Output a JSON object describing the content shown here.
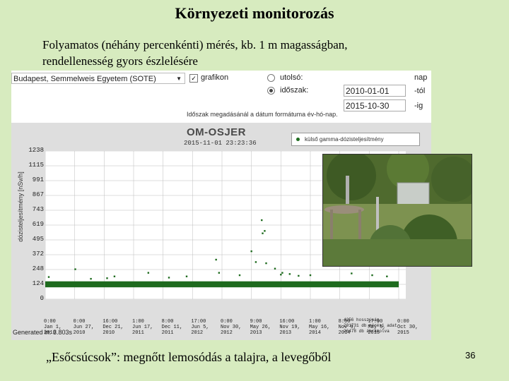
{
  "slide": {
    "title": "Környezeti monitorozás",
    "subtitle_line1": "Folyamatos (néhány percenkénti) mérés, kb. 1 m magasságban,",
    "subtitle_line2": "rendellenesség gyors észlelésére",
    "caption": "„Esőcsúcsok”: megnőtt lemosódás a talajra, a levegőből",
    "page_number": "36"
  },
  "form": {
    "station": "Budapest, Semmelweis Egyetem (SOTE)",
    "graph_checkbox_label": "grafikon",
    "graph_checked": true,
    "radio_last_label": "utolsó:",
    "radio_period_label": "időszak:",
    "period_selected": true,
    "last_suffix": "nap",
    "date_from": "2010-01-01",
    "date_from_suffix": "-tól",
    "date_to": "2015-10-30",
    "date_to_suffix": "-ig",
    "hint": "Időszak megadásánál a dátum formátuma év-hó-nap."
  },
  "chart": {
    "title": "OM-OSJER",
    "timestamp": "2015-11-01 23:23:36",
    "legend": "külső gamma-dózisteljesítmény",
    "series_color": "#1e6b1e",
    "y_label": "dózisteljesítmény [nSv/h]",
    "generated": "Generated in: 3.803s",
    "stats": [
      "4256 hosszúság",
      "201731 db mérési adat",
      "26478 db ábrázolva"
    ]
  },
  "chart_data": {
    "type": "scatter",
    "title": "OM-OSJER",
    "ylabel": "dózisteljesítmény [nSv/h]",
    "ylim": [
      0,
      1238
    ],
    "y_ticks": [
      "1238",
      "1115",
      "991",
      "867",
      "743",
      "619",
      "495",
      "372",
      "248",
      "124",
      "0"
    ],
    "x_ticks": [
      "0:00\nJan 1,\n2010",
      "0:00\nJun 27,\n2010",
      "16:00\nDec 21,\n2010",
      "1:00\nJun 17,\n2011",
      "8:00\nDec 11,\n2011",
      "17:00\nJun 5,\n2012",
      "0:00\nNov 30,\n2012",
      "9:00\nMay 26,\n2013",
      "16:00\nNov 19,\n2013",
      "1:00\nMay 16,\n2014",
      "8:00\nNov 9,\n2014",
      "17:00\nMay 5,\n2015",
      "0:00\nOct 30,\n2015"
    ],
    "baseline": 124,
    "series": [
      {
        "name": "külső gamma-dózisteljesítmény",
        "points": [
          {
            "x": 0.12,
            "y": 185
          },
          {
            "x": 1.02,
            "y": 250
          },
          {
            "x": 1.55,
            "y": 170
          },
          {
            "x": 2.1,
            "y": 175
          },
          {
            "x": 2.35,
            "y": 190
          },
          {
            "x": 3.5,
            "y": 220
          },
          {
            "x": 4.2,
            "y": 180
          },
          {
            "x": 4.8,
            "y": 190
          },
          {
            "x": 5.8,
            "y": 330
          },
          {
            "x": 5.9,
            "y": 220
          },
          {
            "x": 6.6,
            "y": 200
          },
          {
            "x": 7.0,
            "y": 400
          },
          {
            "x": 7.15,
            "y": 310
          },
          {
            "x": 7.35,
            "y": 660
          },
          {
            "x": 7.38,
            "y": 550
          },
          {
            "x": 7.45,
            "y": 570
          },
          {
            "x": 7.5,
            "y": 300
          },
          {
            "x": 7.8,
            "y": 255
          },
          {
            "x": 8.0,
            "y": 205
          },
          {
            "x": 8.05,
            "y": 220
          },
          {
            "x": 8.3,
            "y": 210
          },
          {
            "x": 8.6,
            "y": 195
          },
          {
            "x": 9.0,
            "y": 200
          },
          {
            "x": 10.0,
            "y": 285
          },
          {
            "x": 10.3,
            "y": 350
          },
          {
            "x": 10.4,
            "y": 215
          },
          {
            "x": 11.1,
            "y": 200
          },
          {
            "x": 11.6,
            "y": 190
          }
        ]
      }
    ]
  }
}
